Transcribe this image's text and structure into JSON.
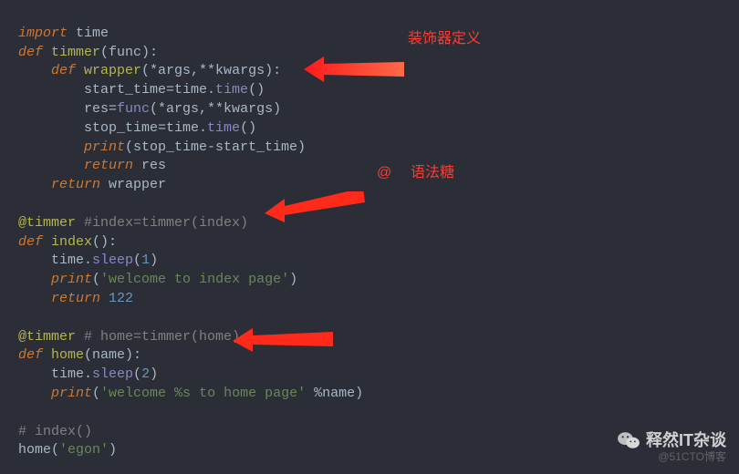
{
  "code": {
    "l1": {
      "kw": "import",
      "mod": " time"
    },
    "l2": {
      "kw": "def ",
      "fn": "timmer",
      "rest": "(func):"
    },
    "l3": {
      "kw": "def ",
      "fn": "wrapper",
      "rest": "(*args,**kwargs):"
    },
    "l4": {
      "a": "start_time=time.",
      "b": "time",
      "c": "()"
    },
    "l5": {
      "a": "res=",
      "b": "func",
      "c": "(*args,**kwargs)"
    },
    "l6": {
      "a": "stop_time=time.",
      "b": "time",
      "c": "()"
    },
    "l7": {
      "kw": "print",
      "rest": "(stop_time-start_time)"
    },
    "l8": {
      "kw": "return ",
      "rest": "res"
    },
    "l9": {
      "kw": "return ",
      "rest": "wrapper"
    },
    "l10": {
      "dec": "@timmer ",
      "cm": "#index=timmer(index)"
    },
    "l11": {
      "kw": "def ",
      "fn": "index",
      "rest": "():"
    },
    "l12": {
      "a": "time.",
      "b": "sleep",
      "c": "(",
      "n": "1",
      "d": ")"
    },
    "l13": {
      "kw": "print",
      "a": "(",
      "s": "'welcome to index page'",
      "b": ")"
    },
    "l14": {
      "kw": "return ",
      "n": "122"
    },
    "l15": {
      "dec": "@timmer ",
      "cm": "# home=timmer(home)"
    },
    "l16": {
      "kw": "def ",
      "fn": "home",
      "rest": "(name):"
    },
    "l17": {
      "a": "time.",
      "b": "sleep",
      "c": "(",
      "n": "2",
      "d": ")"
    },
    "l18": {
      "kw": "print",
      "a": "(",
      "s": "'welcome %s to home page'",
      "b": " %name)"
    },
    "l19": {
      "cm": "# index()"
    },
    "l20": {
      "a": "home(",
      "s": "'egon'",
      "b": ")"
    }
  },
  "annotations": {
    "a1": "装饰器定义",
    "a2_at": "@",
    "a2_txt": "语法糖"
  },
  "watermark": {
    "wechat_label": "释然IT杂谈",
    "credit": "@51CTO博客"
  }
}
